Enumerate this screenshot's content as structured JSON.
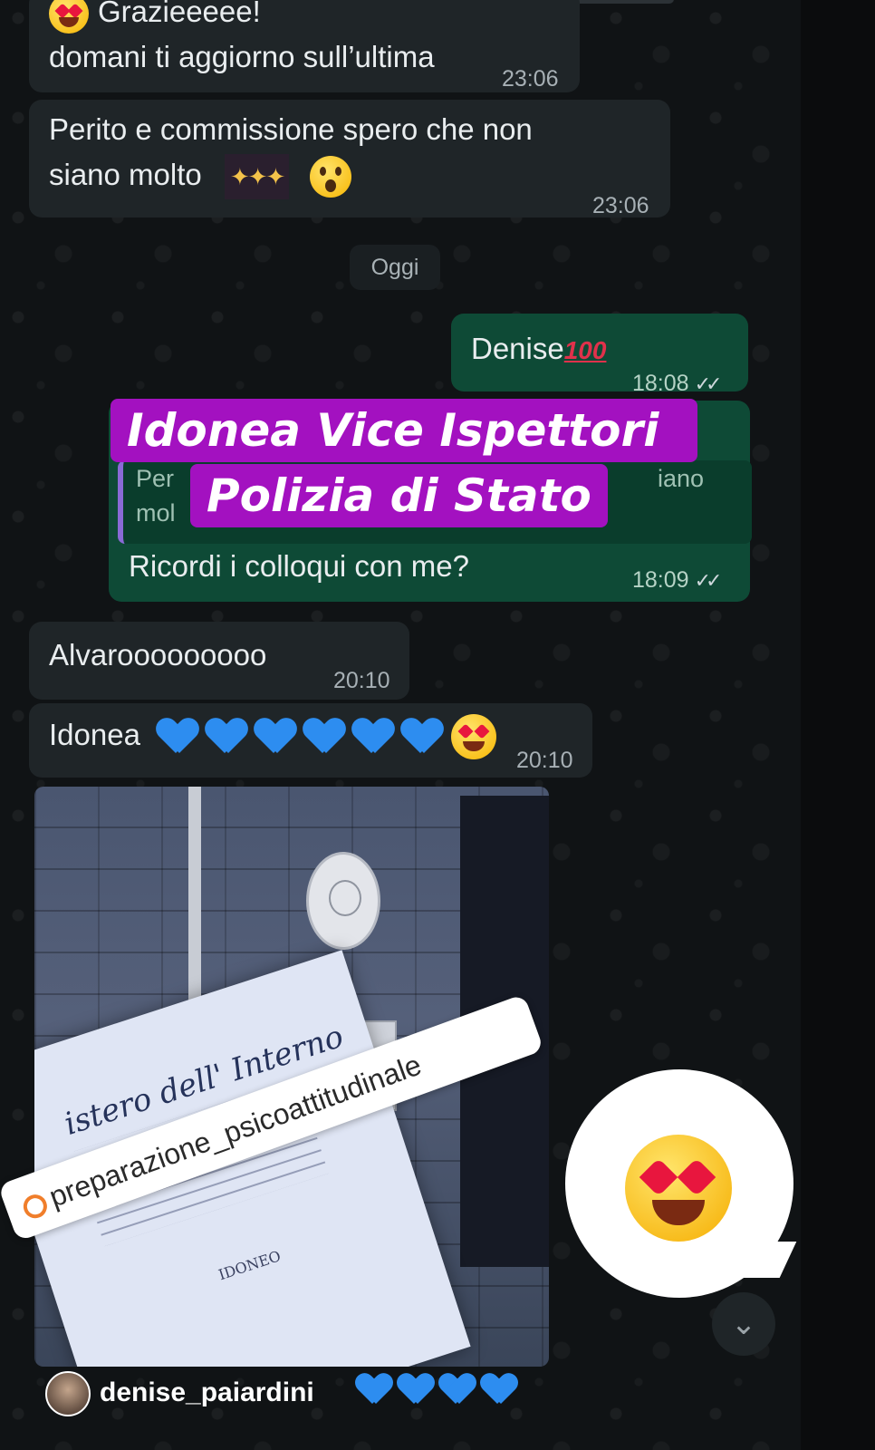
{
  "messages": [
    {
      "line1": "Grazieeeee!",
      "line2": "domani ti aggiorno sull’ultima",
      "time": "23:06"
    },
    {
      "line1": "Perito e commissione spero che non",
      "line2": "siano molto",
      "time": "23:06"
    }
  ],
  "date_separator": "Oggi",
  "outgoing": [
    {
      "text": "Denise",
      "time": "18:08",
      "emoji": "100"
    },
    {
      "quote_left": "Per",
      "quote_left2": "mol",
      "quote_right": "iano",
      "text": "Ricordi i colloqui con me?",
      "time": "18:09"
    }
  ],
  "incoming_today": [
    {
      "text": "Alvarooooooooo",
      "time": "20:10"
    },
    {
      "text": "Idonea",
      "time": "20:10"
    }
  ],
  "overlay": {
    "line1": "Idonea Vice Ispettori",
    "line2": "Polizia di Stato"
  },
  "document": {
    "title": "istero dell' Interno",
    "stamp": "IDONEO"
  },
  "mention": "preparazione_psicoattitudinale",
  "story": {
    "username": "denise_paiardini"
  },
  "colors": {
    "accent_overlay": "#a311c0",
    "incoming_bubble": "#1f2528",
    "outgoing_bubble": "#0e4a36",
    "heart": "#2d8df0"
  },
  "icons": [
    "heart-eyes-emoji",
    "party-popper-emoji",
    "astonished-emoji",
    "hundred-points-emoji",
    "blue-heart-icon",
    "double-check-icon",
    "scroll-down-icon",
    "avatar"
  ]
}
